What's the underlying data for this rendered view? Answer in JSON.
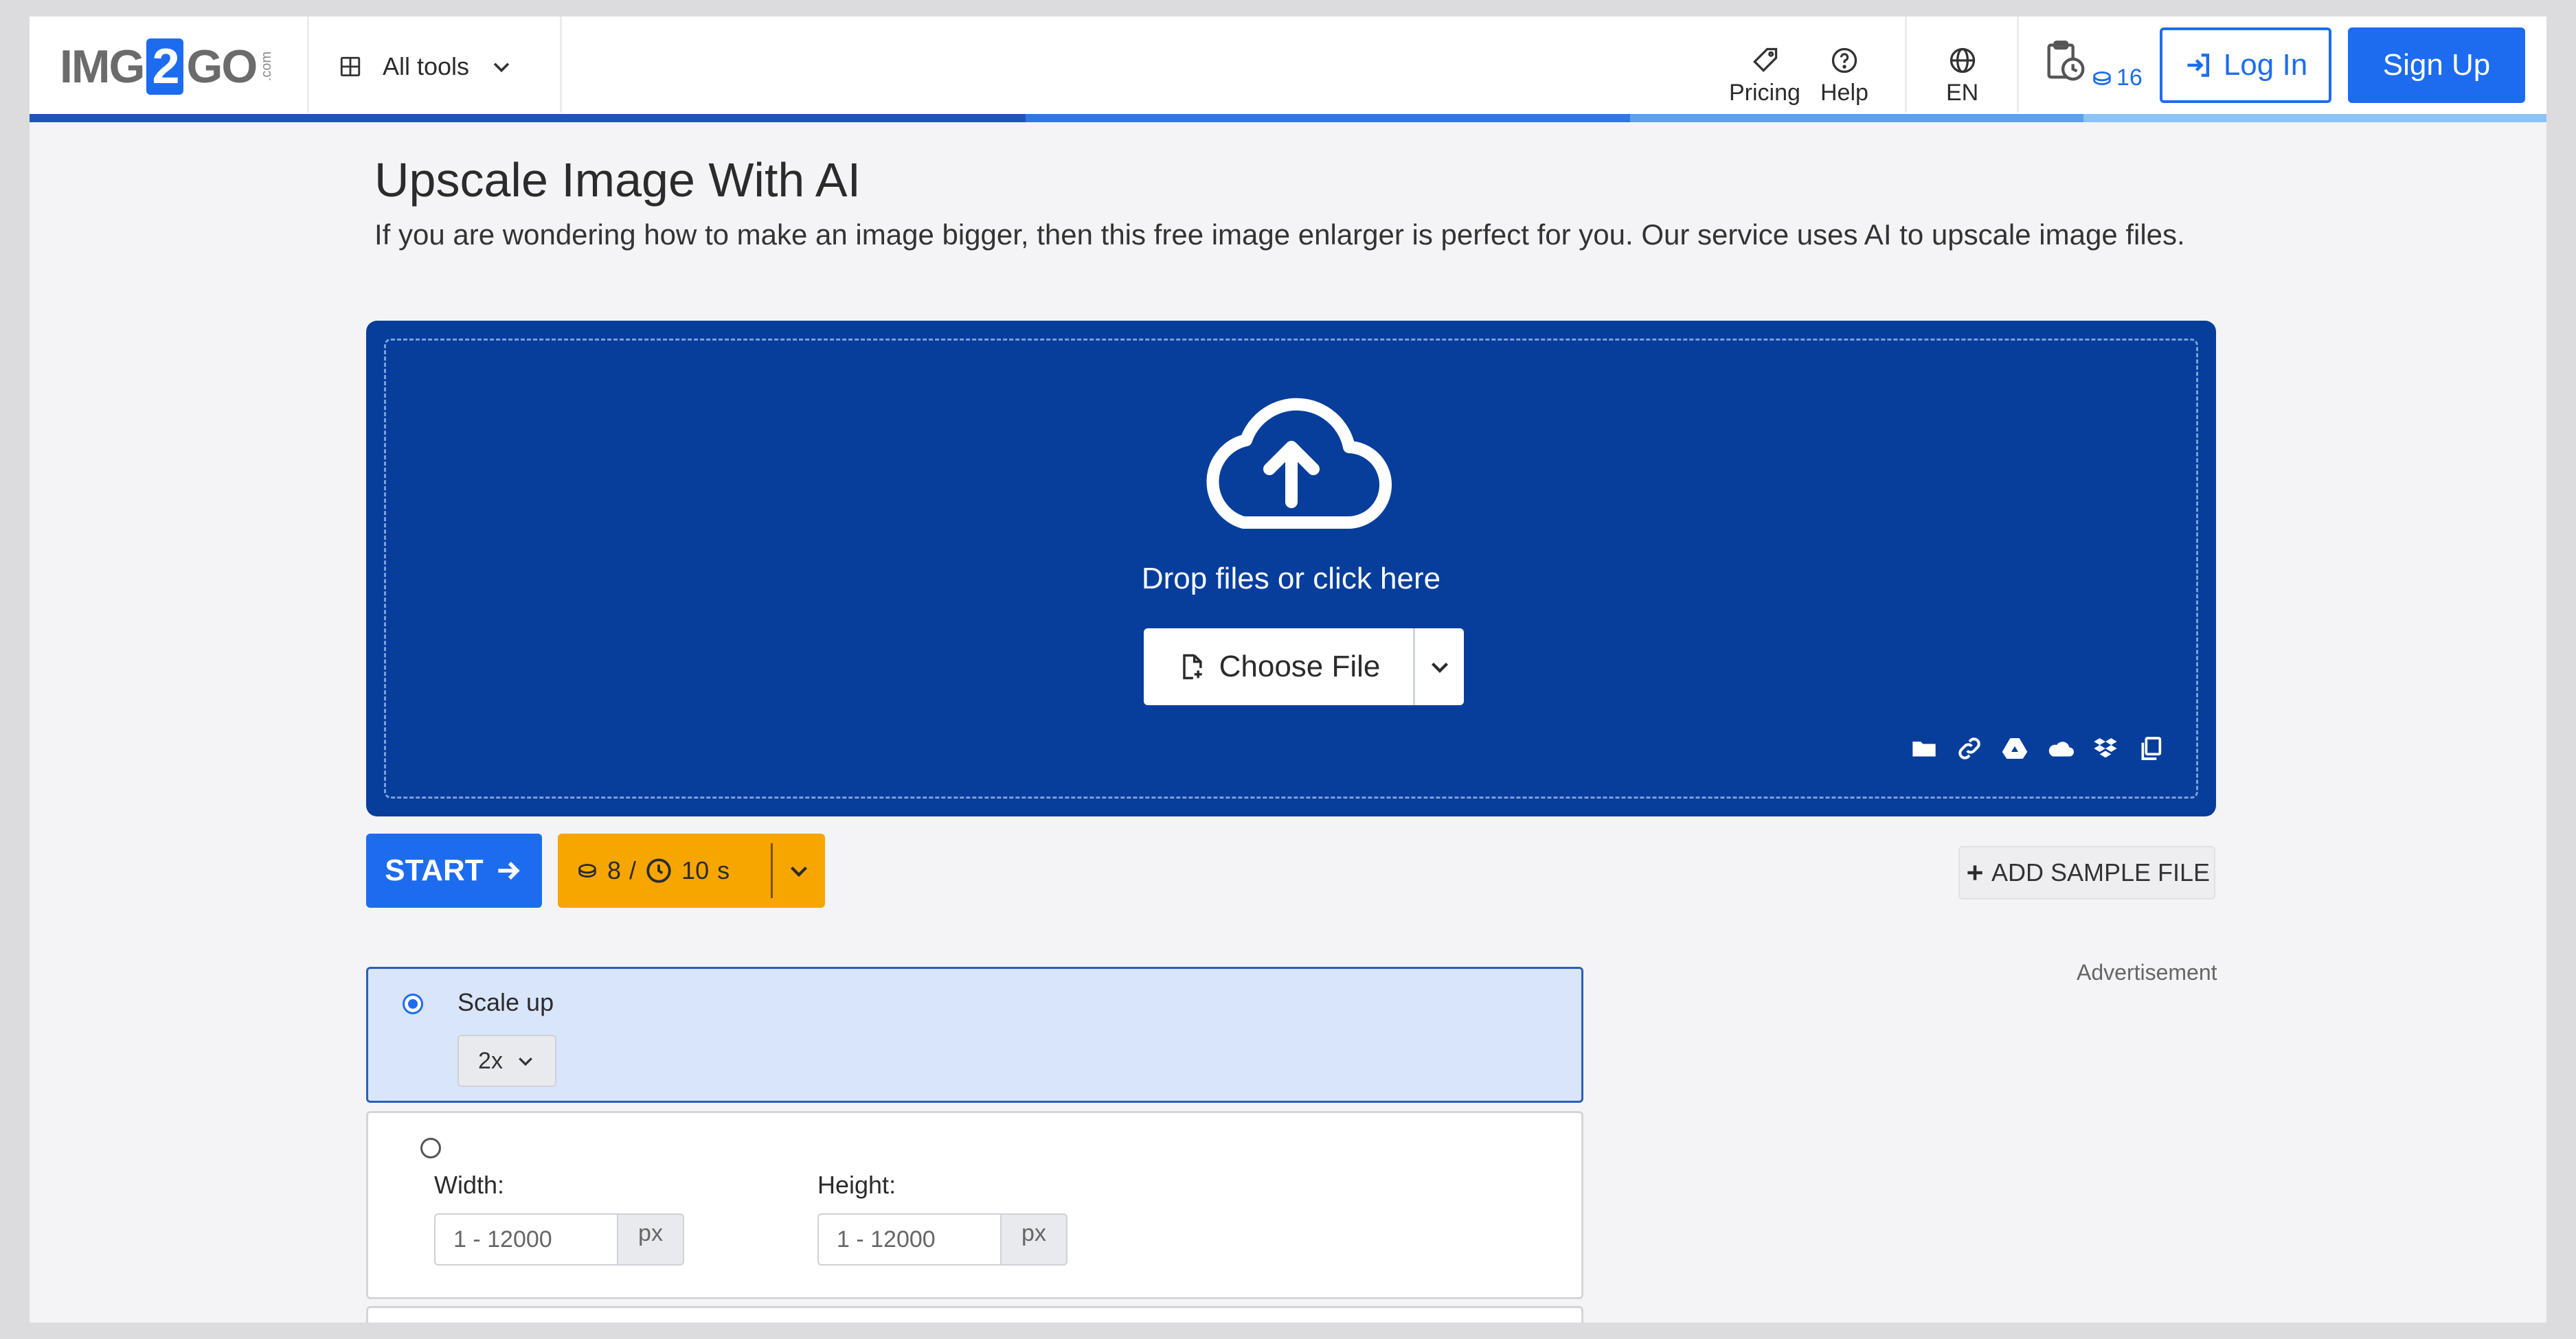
{
  "header": {
    "logo": {
      "left": "IMG",
      "middle": "2",
      "right": "GO",
      "suffix": ".com"
    },
    "all_tools_label": "All tools",
    "pricing_label": "Pricing",
    "help_label": "Help",
    "language_label": "EN",
    "credits_count": "16",
    "login_label": "Log In",
    "signup_label": "Sign Up",
    "progress_colors": [
      "#1f56b5",
      "#2e78e0",
      "#58a2f0",
      "#8cc2f7"
    ]
  },
  "main": {
    "title": "Upscale Image With AI",
    "description": "If you are wondering how to make an image bigger, then this free image enlarger is perfect for you. Our service uses AI to upscale image files."
  },
  "upload": {
    "drop_text": "Drop files or click here",
    "choose_file_label": "Choose File",
    "source_icons": [
      "folder-icon",
      "link-icon",
      "google-drive-icon",
      "onedrive-icon",
      "dropbox-icon",
      "clipboard-icon"
    ]
  },
  "actions": {
    "start_label": "START",
    "cost_credits": "8",
    "cost_separator": "/",
    "cost_time": "10",
    "cost_time_unit": "s",
    "add_sample_label": "ADD SAMPLE FILE",
    "advertisement_label": "Advertisement"
  },
  "options": {
    "scale_up_label": "Scale up",
    "scale_up_value": "2x",
    "width_label": "Width:",
    "width_placeholder": "1 - 12000",
    "width_unit": "px",
    "height_label": "Height:",
    "height_placeholder": "1 - 12000",
    "height_unit": "px"
  },
  "colors": {
    "accent": "#1d6cf0",
    "dropzone": "#073e9c",
    "cost_button": "#f7a600",
    "selected_option": "#d8e5fb"
  }
}
